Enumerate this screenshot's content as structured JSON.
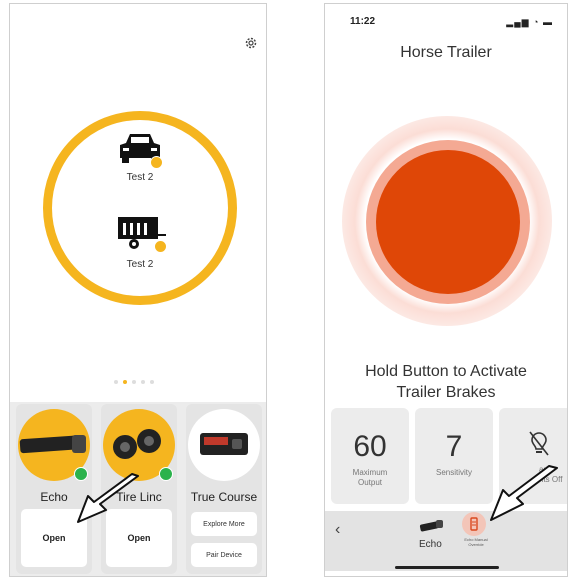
{
  "left": {
    "vehicles": [
      {
        "label": "Test 2",
        "icon": "car-icon"
      },
      {
        "label": "Test 2",
        "icon": "trailer-icon"
      }
    ],
    "page_dots": 5,
    "cards": [
      {
        "name": "Echo",
        "button": "Open"
      },
      {
        "name": "Tire Linc",
        "button": "Open"
      },
      {
        "name": "True Course",
        "buttons": [
          "Explore More",
          "Pair Device"
        ]
      }
    ]
  },
  "right": {
    "status_time": "11:22",
    "title": "Horse Trailer",
    "hold_line1": "Hold Button to Activate",
    "hold_line2": "Trailer Brakes",
    "tiles": [
      {
        "value": "60",
        "label1": "Maximum",
        "label2": "Output"
      },
      {
        "value": "7",
        "label1": "Sensitivity",
        "label2": ""
      },
      {
        "label1": "ard",
        "label2": "nts Off"
      }
    ],
    "bottom": {
      "back": "‹",
      "echo": "Echo",
      "override_line1": "Echo Manual",
      "override_line2": "Override"
    }
  },
  "colors": {
    "accent": "#f5b51f",
    "brake": "#df4707",
    "bluetooth": "#2bb24c"
  }
}
